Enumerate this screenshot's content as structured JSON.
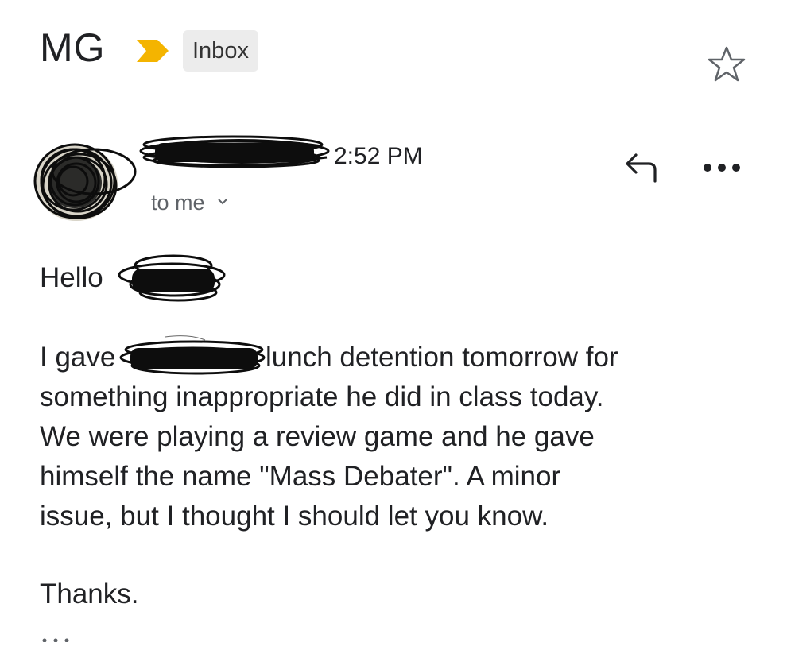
{
  "header": {
    "subject": "MG",
    "label": "Inbox",
    "important_marker_color": "#f4b400",
    "star_icon": "star-outline-icon"
  },
  "sender": {
    "time": "2:52 PM",
    "recipients": "to me",
    "recipients_chevron": "chevron-down-icon",
    "reply_icon": "reply-icon",
    "more_icon": "more-horizontal-icon"
  },
  "message": {
    "greeting": "Hello",
    "line1_start": "I gave",
    "line1_end": "lunch detention tomorrow for",
    "line2": "something inappropriate he did in class today.",
    "line3": "We were playing a review game and he gave",
    "line4": "himself the name \"Mass Debater\". A minor",
    "line5": "issue, but I thought I should let you know.",
    "signoff": "Thanks."
  },
  "colors": {
    "text": "#202124",
    "secondary_text": "#5f6368",
    "chip_background": "#ececec",
    "redaction": "#0d0d0d"
  }
}
